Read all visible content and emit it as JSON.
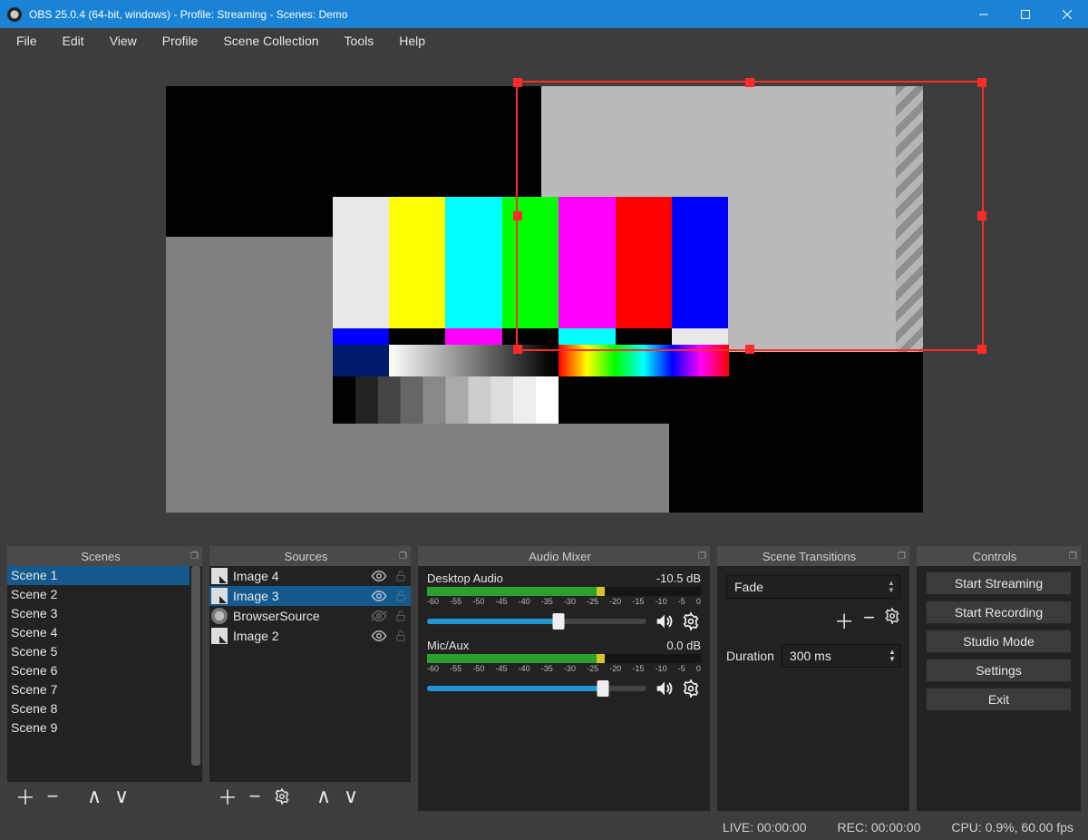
{
  "titlebar": {
    "title": "OBS 25.0.4 (64-bit, windows) - Profile: Streaming - Scenes: Demo"
  },
  "menu": [
    "File",
    "Edit",
    "View",
    "Profile",
    "Scene Collection",
    "Tools",
    "Help"
  ],
  "docks": {
    "scenes_title": "Scenes",
    "sources_title": "Sources",
    "mixer_title": "Audio Mixer",
    "transitions_title": "Scene Transitions",
    "controls_title": "Controls"
  },
  "scenes": [
    "Scene 1",
    "Scene 2",
    "Scene 3",
    "Scene 4",
    "Scene 5",
    "Scene 6",
    "Scene 7",
    "Scene 8",
    "Scene 9"
  ],
  "scenes_selected_index": 0,
  "sources": [
    {
      "name": "Image 4",
      "type": "image",
      "visible": true,
      "locked": false
    },
    {
      "name": "Image 3",
      "type": "image",
      "visible": true,
      "locked": false,
      "selected": true
    },
    {
      "name": "BrowserSource",
      "type": "browser",
      "visible": false,
      "locked": false
    },
    {
      "name": "Image 2",
      "type": "image",
      "visible": true,
      "locked": false
    }
  ],
  "mixer": {
    "channels": [
      {
        "name": "Desktop Audio",
        "db": "-10.5 dB",
        "slider_pct": 60
      },
      {
        "name": "Mic/Aux",
        "db": "0.0 dB",
        "slider_pct": 80
      }
    ],
    "tick_labels": [
      "-60",
      "-55",
      "-50",
      "-45",
      "-40",
      "-35",
      "-30",
      "-25",
      "-20",
      "-15",
      "-10",
      "-5",
      "0"
    ]
  },
  "transitions": {
    "current": "Fade",
    "duration_label": "Duration",
    "duration_value": "300 ms"
  },
  "controls": {
    "buttons": [
      "Start Streaming",
      "Start Recording",
      "Studio Mode",
      "Settings",
      "Exit"
    ]
  },
  "status": {
    "live": "LIVE: 00:00:00",
    "rec": "REC: 00:00:00",
    "cpu": "CPU: 0.9%, 60.00 fps"
  }
}
